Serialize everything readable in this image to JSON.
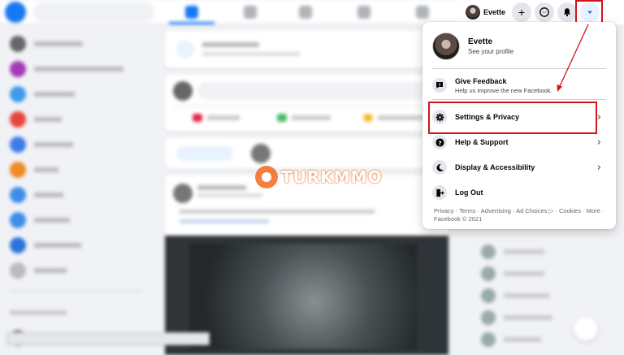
{
  "header": {
    "profile_name": "Evette",
    "create_icon": "plus-icon",
    "messenger_icon": "messenger-icon",
    "notifications_icon": "bell-icon",
    "account_icon": "caret-down-icon"
  },
  "menu": {
    "profile": {
      "name": "Evette",
      "subtitle": "See your profile"
    },
    "feedback": {
      "label": "Give Feedback",
      "description": "Help us improve the new Facebook."
    },
    "items": [
      {
        "label": "Settings & Privacy",
        "icon": "gear-icon"
      },
      {
        "label": "Help & Support",
        "icon": "question-icon"
      },
      {
        "label": "Display & Accessibility",
        "icon": "moon-icon"
      },
      {
        "label": "Log Out",
        "icon": "logout-icon"
      }
    ],
    "footer": "Privacy · Terms · Advertising · Ad Choices ▷ · Cookies · More · Facebook © 2021"
  },
  "watermark": {
    "text": "TURKMMO"
  },
  "colors": {
    "accent": "#1877f2",
    "highlight": "#d3131b",
    "watermark": "#f26b1d"
  }
}
